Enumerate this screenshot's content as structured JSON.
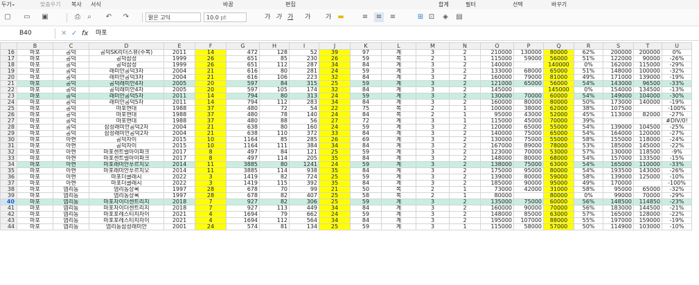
{
  "ribbon": {
    "items": [
      "두기",
      "맞춤우기",
      "복사",
      "서식",
      "바꿈",
      "편집",
      "합계",
      "필터",
      "선택",
      "바꾸기"
    ]
  },
  "toolbar": {
    "font_name": "맑은 고딕",
    "font_size": "10.0",
    "font_unit": "pt",
    "fmt_labels": [
      "가",
      "가",
      "가",
      "가",
      "가"
    ]
  },
  "formula_bar": {
    "cell_ref": "B40",
    "fx": "fx",
    "content": "마포"
  },
  "columns": [
    "B",
    "C",
    "D",
    "E",
    "F",
    "G",
    "H",
    "I",
    "J",
    "K",
    "L",
    "M",
    "N",
    "O",
    "P",
    "Q",
    "R",
    "S",
    "T",
    "U"
  ],
  "selected_row": "40",
  "rows": [
    {
      "n": "16",
      "v": [
        "마포",
        "공덕",
        "공덕SK리더스뷰(주복)",
        "2011",
        "14",
        "472",
        "128",
        "52",
        "39",
        "97",
        "계",
        "3",
        "2",
        "210000",
        "130000",
        "80000",
        "62%",
        "200000",
        "200000",
        "0%"
      ]
    },
    {
      "n": "17",
      "v": [
        "마포",
        "공덕",
        "공덕삼성",
        "1999",
        "26",
        "651",
        "85",
        "230",
        "26",
        "59",
        "복",
        "2",
        "1",
        "115000",
        "59000",
        "56000",
        "51%",
        "122000",
        "90000",
        "-26%"
      ]
    },
    {
      "n": "18",
      "v": [
        "마포",
        "공덕",
        "공덕삼성",
        "1999",
        "26",
        "651",
        "112",
        "287",
        "34",
        "84",
        "계",
        "3",
        "2",
        "140000",
        "",
        "140000",
        "0%",
        "162000",
        "115000",
        "-29%"
      ]
    },
    {
      "n": "19",
      "v": [
        "마포",
        "공덕",
        "래미안공덕3차",
        "2004",
        "21",
        "616",
        "80",
        "281",
        "24",
        "59",
        "계",
        "3",
        "2",
        "133000",
        "68000",
        "65000",
        "51%",
        "148000",
        "100000",
        "-32%"
      ]
    },
    {
      "n": "20",
      "v": [
        "마포",
        "공덕",
        "래미안공덕3차",
        "2004",
        "21",
        "616",
        "106",
        "223",
        "32",
        "84",
        "계",
        "3",
        "2",
        "160000",
        "79000",
        "81000",
        "49%",
        "171000",
        "139000",
        "-19%"
      ]
    },
    {
      "n": "21",
      "v": [
        "마포",
        "공덕",
        "공덕래미안4차",
        "2005",
        "20",
        "597",
        "84",
        "315",
        "25",
        "59",
        "계",
        "3",
        "2",
        "121000",
        "65000",
        "56000",
        "54%",
        "143000",
        "96500",
        "-33%"
      ]
    },
    {
      "n": "22",
      "v": [
        "마포",
        "공덕",
        "공덕래미안4차",
        "2005",
        "20",
        "597",
        "105",
        "174",
        "32",
        "84",
        "계",
        "3",
        "2",
        "145000",
        "",
        "145000",
        "0%",
        "154000",
        "134500",
        "-13%"
      ]
    },
    {
      "n": "23",
      "v": [
        "마포",
        "공덕",
        "래미안공덕5차",
        "2011",
        "14",
        "794",
        "80",
        "313",
        "24",
        "59",
        "계",
        "3",
        "2",
        "130000",
        "70000",
        "60000",
        "54%",
        "149000",
        "104000",
        "-30%"
      ]
    },
    {
      "n": "24",
      "v": [
        "마포",
        "공덕",
        "래미안공덕5차",
        "2011",
        "14",
        "794",
        "112",
        "283",
        "34",
        "84",
        "계",
        "3",
        "2",
        "160000",
        "80000",
        "80000",
        "50%",
        "173000",
        "140000",
        "-19%"
      ]
    },
    {
      "n": "25",
      "v": [
        "마포",
        "공덕",
        "마포현대",
        "1988",
        "37",
        "480",
        "72",
        "54",
        "22",
        "75",
        "복",
        "2",
        "1",
        "100000",
        "38000",
        "62000",
        "38%",
        "107500",
        "",
        "-100%"
      ]
    },
    {
      "n": "26",
      "v": [
        "마포",
        "공덕",
        "마포현대",
        "1988",
        "37",
        "480",
        "78",
        "140",
        "24",
        "84",
        "복",
        "2",
        "1",
        "95000",
        "43000",
        "52000",
        "45%",
        "113000",
        "82000",
        "-27%"
      ]
    },
    {
      "n": "27",
      "v": [
        "마포",
        "공덕",
        "마포현대",
        "1988",
        "37",
        "480",
        "88",
        "56",
        "27",
        "72",
        "계",
        "3",
        "1",
        "115000",
        "45000",
        "70000",
        "39%",
        "",
        "",
        "#DIV/0!"
      ]
    },
    {
      "n": "28",
      "v": [
        "마포",
        "공덕",
        "삼성래미안공덕2차",
        "2004",
        "21",
        "638",
        "80",
        "160",
        "24",
        "59",
        "계",
        "3",
        "2",
        "120000",
        "65000",
        "55000",
        "54%",
        "139000",
        "104500",
        "-25%"
      ]
    },
    {
      "n": "29",
      "v": [
        "마포",
        "공덕",
        "삼성래미안공덕2차",
        "2004",
        "21",
        "638",
        "110",
        "372",
        "33",
        "84",
        "계",
        "3",
        "2",
        "140000",
        "75000",
        "65000",
        "54%",
        "164000",
        "120000",
        "-27%"
      ]
    },
    {
      "n": "30",
      "v": [
        "마포",
        "아현",
        "공덕자이",
        "2015",
        "10",
        "1164",
        "85",
        "285",
        "26",
        "69",
        "계",
        "3",
        "2",
        "130000",
        "75000",
        "55000",
        "58%",
        "155000",
        "118000",
        "-24%"
      ]
    },
    {
      "n": "31",
      "v": [
        "마포",
        "아현",
        "공덕자이",
        "2015",
        "10",
        "1164",
        "111",
        "384",
        "34",
        "84",
        "계",
        "3",
        "2",
        "167000",
        "89000",
        "78000",
        "53%",
        "185000",
        "145000",
        "-22%"
      ]
    },
    {
      "n": "32",
      "v": [
        "마포",
        "아현",
        "마포센트럴아이파크",
        "2017",
        "8",
        "497",
        "84",
        "121",
        "25",
        "59",
        "계",
        "3",
        "2",
        "123000",
        "70000",
        "53000",
        "57%",
        "130000",
        "118500",
        "-9%"
      ]
    },
    {
      "n": "33",
      "v": [
        "마포",
        "아현",
        "마포센트럴아이파크",
        "2017",
        "8",
        "497",
        "114",
        "205",
        "35",
        "84",
        "계",
        "3",
        "2",
        "148000",
        "80000",
        "68000",
        "54%",
        "157000",
        "133500",
        "-15%"
      ]
    },
    {
      "n": "34",
      "v": [
        "마포",
        "아현",
        "마포래미안푸르지오",
        "2014",
        "11",
        "3885",
        "80",
        "1241",
        "24",
        "59",
        "계",
        "3",
        "2",
        "138000",
        "75000",
        "63000",
        "54%",
        "165000",
        "110000",
        "-33%"
      ]
    },
    {
      "n": "35",
      "v": [
        "마포",
        "아현",
        "마포래미안푸르지오",
        "2014",
        "11",
        "3885",
        "114",
        "938",
        "35",
        "84",
        "계",
        "3",
        "2",
        "175000",
        "95000",
        "80000",
        "54%",
        "193500",
        "143000",
        "-26%"
      ]
    },
    {
      "n": "36",
      "v": [
        "마포",
        "아현",
        "마포더클래시",
        "2022",
        "3",
        "1419",
        "82",
        "724",
        "25",
        "59",
        "계",
        "3",
        "2",
        "139000",
        "80000",
        "59000",
        "58%",
        "139000",
        "125000",
        "-10%"
      ]
    },
    {
      "n": "37",
      "v": [
        "마포",
        "아현",
        "마포더클래시",
        "2022",
        "3",
        "1419",
        "115",
        "392",
        "35",
        "84",
        "계",
        "3",
        "2",
        "185000",
        "90000",
        "95000",
        "49%",
        "170000",
        "",
        "-100%"
      ]
    },
    {
      "n": "38",
      "v": [
        "마포",
        "염리동",
        "염리동상록",
        "1997",
        "28",
        "678",
        "70",
        "99",
        "21",
        "50",
        "복",
        "2",
        "1",
        "73000",
        "42000",
        "31000",
        "58%",
        "95000",
        "65000",
        "-32%"
      ]
    },
    {
      "n": "39",
      "v": [
        "마포",
        "염리동",
        "염리동상록",
        "1997",
        "28",
        "678",
        "82",
        "407",
        "25",
        "58",
        "복",
        "2",
        "1",
        "80000",
        "",
        "80000",
        "0%",
        "99000",
        "70000",
        "-29%"
      ]
    },
    {
      "n": "40",
      "v": [
        "마포",
        "염리동",
        "마포자이더센트리지",
        "2018",
        "7",
        "927",
        "82",
        "306",
        "25",
        "59",
        "계",
        "3",
        "2",
        "135000",
        "75000",
        "60000",
        "56%",
        "148500",
        "114850",
        "-23%"
      ]
    },
    {
      "n": "41",
      "v": [
        "마포",
        "염리동",
        "마포자이더센트리지",
        "2018",
        "7",
        "927",
        "113",
        "449",
        "34",
        "84",
        "계",
        "3",
        "2",
        "160000",
        "90000",
        "70000",
        "56%",
        "183000",
        "144500",
        "-21%"
      ]
    },
    {
      "n": "42",
      "v": [
        "마포",
        "염리동",
        "마포포레스티지자이",
        "2021",
        "4",
        "1694",
        "79",
        "662",
        "24",
        "59",
        "계",
        "3",
        "2",
        "148000",
        "85000",
        "63000",
        "57%",
        "165000",
        "128000",
        "-22%"
      ]
    },
    {
      "n": "43",
      "v": [
        "마포",
        "염리동",
        "마포포레스티지자이",
        "2021",
        "4",
        "1694",
        "112",
        "564",
        "34",
        "84",
        "계",
        "3",
        "2",
        "195000",
        "107000",
        "88000",
        "55%",
        "197000",
        "159000",
        "-19%"
      ]
    },
    {
      "n": "44",
      "v": [
        "마포",
        "염리동",
        "염리동삼성래미안",
        "2001",
        "24",
        "574",
        "81",
        "134",
        "25",
        "59",
        "계",
        "3",
        "1",
        "115000",
        "58000",
        "57000",
        "50%",
        "114900",
        "103000",
        "-10%"
      ]
    }
  ],
  "highlight": {
    "yellow_cols": [
      "F",
      "J",
      "Q"
    ],
    "green_rows": [
      "21",
      "23",
      "34",
      "40"
    ]
  },
  "colors": {
    "yellow": "#ffff00",
    "green": "#c9eee0",
    "selected_header": "#cfe3f7"
  }
}
